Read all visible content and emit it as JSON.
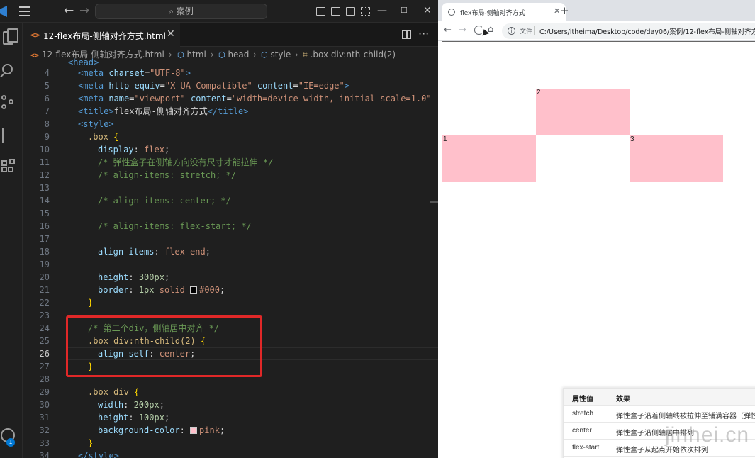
{
  "vscode": {
    "search_placeholder": "案例",
    "tab_label": "12-flex布局-侧轴对齐方式.html",
    "tab_icon": "<>",
    "breadcrumb": {
      "file": "12-flex布局-侧轴对齐方式.html",
      "html": "html",
      "head": "head",
      "style": "style",
      "selector": ".box div:nth-child(2)"
    },
    "line_numbers": [
      "4",
      "5",
      "6",
      "7",
      "8",
      "9",
      "10",
      "11",
      "12",
      "13",
      "14",
      "15",
      "16",
      "17",
      "18",
      "19",
      "20",
      "21",
      "22",
      "23",
      "24",
      "25",
      "26",
      "27",
      "28",
      "29",
      "30",
      "31",
      "32",
      "33",
      "34"
    ],
    "active_line": "26",
    "code": {
      "l4_tag": "<meta",
      "l4_attr": "charset",
      "l4_val": "\"UTF-8\"",
      "l5_tag": "<meta",
      "l5_attr1": "http-equiv",
      "l5_val1": "\"X-UA-Compatible\"",
      "l5_attr2": "content",
      "l5_val2": "\"IE=edge\"",
      "l6_tag": "<meta",
      "l6_attr1": "name",
      "l6_val1": "\"viewport\"",
      "l6_attr2": "content",
      "l6_val2": "\"width=device-width, initial-scale=1.0\"",
      "l7_open": "<title>",
      "l7_text": "flex布局-侧轴对齐方式",
      "l7_close": "</title>",
      "l8_tag": "<style>",
      "l9_sel": ".box",
      "l10_prop": "display",
      "l10_val": "flex",
      "l11_com": "/* 弹性盒子在侧轴方向没有尺寸才能拉伸 */",
      "l12_com": "/* align-items: stretch; */",
      "l14_com": "/* align-items: center; */",
      "l16_com": "/* align-items: flex-start; */",
      "l18_prop": "align-items",
      "l18_val": "flex-end",
      "l20_prop": "height",
      "l20_val": "300px",
      "l21_prop": "border",
      "l21_val1": "1px",
      "l21_val2": "solid",
      "l21_val3": "#000",
      "l24_com": "/* 第二个div，侧轴居中对齐 */",
      "l25_sel": ".box div:nth-child(2)",
      "l26_prop": "align-self",
      "l26_val": "center",
      "l29_sel": ".box div",
      "l30_prop": "width",
      "l30_val": "200px",
      "l31_prop": "height",
      "l31_val": "100px",
      "l32_prop": "background-color",
      "l32_val": "pink",
      "l34_tag": "</style>"
    }
  },
  "browser": {
    "tab_title": "flex布局-侧轴对齐方式",
    "address_prefix": "文件",
    "address_url": "C:/Users/itheima/Desktop/code/day06/案例/12-flex布局-侧轴对齐方式",
    "demo_items": [
      "1",
      "2",
      "3"
    ],
    "table": {
      "headers": [
        "属性值",
        "效果"
      ],
      "rows": [
        [
          "stretch",
          "弹性盒子沿着侧轴线被拉伸至铺满容器（弹性"
        ],
        [
          "center",
          "弹性盒子沿侧轴居中排列"
        ],
        [
          "flex-start",
          "弹性盒子从起点开始依次排列"
        ]
      ]
    },
    "watermark": "jinhei.cn"
  },
  "colors": {
    "accent": "#0078d4",
    "highlight": "#e02828",
    "pink": "#ffc0cb"
  }
}
